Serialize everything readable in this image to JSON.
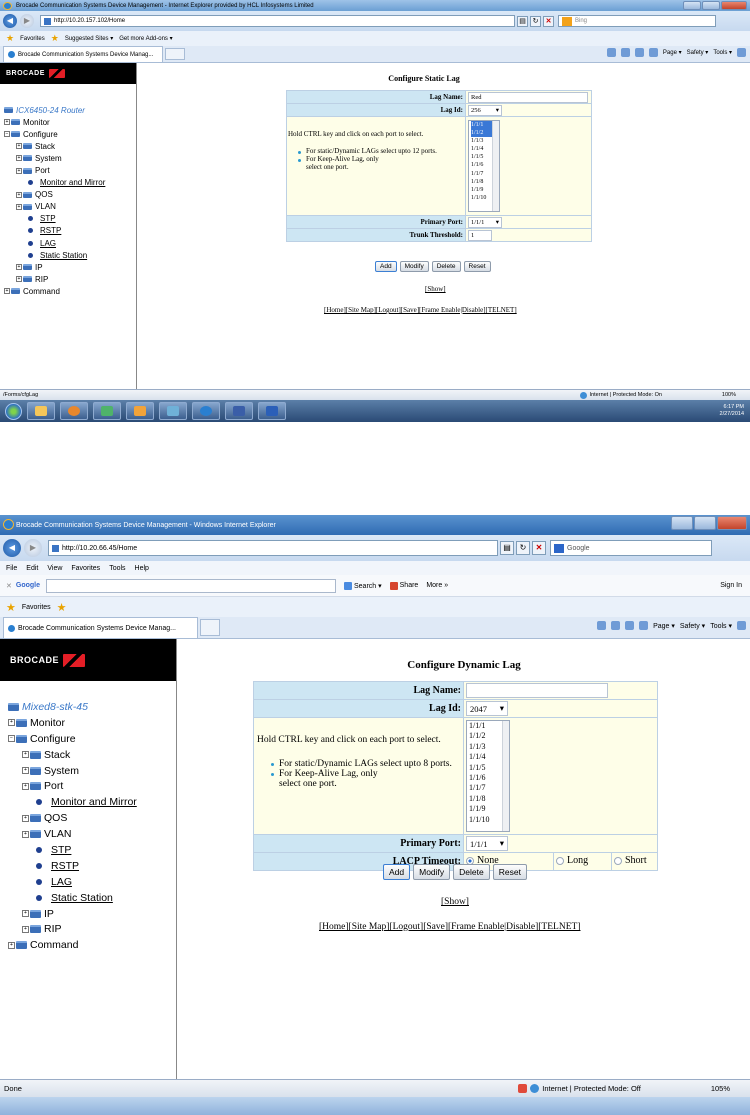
{
  "shot1": {
    "window_title": "Brocade Communication Systems Device Management - Internet Explorer provided by HCL Infosystems Limited",
    "address": "http://10.20.157.102/Home",
    "search_placeholder": "Bing",
    "favorites": [
      "Favorites",
      "Suggested Sites ▾",
      "Get more Add-ons ▾"
    ],
    "tab_title": "Brocade Communication Systems Device Manag...",
    "commands": [
      "Page ▾",
      "Safety ▾",
      "Tools ▾"
    ],
    "logo": "BROCADE",
    "tree": {
      "root": "ICX6450-24 Router",
      "monitor": "Monitor",
      "configure": "Configure",
      "stack": "Stack",
      "system": "System",
      "port": "Port",
      "monitor_mirror": "Monitor and Mirror",
      "qos": "QOS",
      "vlan": "VLAN",
      "stp": "STP",
      "rstp": "RSTP",
      "lag": "LAG",
      "static_station": "Static Station",
      "ip": "IP",
      "rip": "RIP",
      "command": "Command"
    },
    "page_title": "Configure Static Lag",
    "form": {
      "lag_name_label": "Lag Name:",
      "lag_name_value": "Red",
      "lag_id_label": "Lag Id:",
      "lag_id_value": "256",
      "hint": "Hold CTRL key and click on each port to select.",
      "bullet1": "For static/Dynamic LAGs select upto 12 ports.",
      "bullet2a": "For Keep-Alive Lag, only",
      "bullet2b": "select one port.",
      "ports": [
        "1/1/1",
        "1/1/2",
        "1/1/3",
        "1/1/4",
        "1/1/5",
        "1/1/6",
        "1/1/7",
        "1/1/8",
        "1/1/9",
        "1/1/10"
      ],
      "primary_port_label": "Primary Port:",
      "primary_port_value": "1/1/1",
      "trunk_label": "Trunk Threshold:",
      "trunk_value": "1"
    },
    "buttons": {
      "add": "Add",
      "modify": "Modify",
      "delete": "Delete",
      "reset": "Reset"
    },
    "show_link": "[Show]",
    "footer_links": "[Home][Site Map][Logout][Save][Frame Enable|Disable][TELNET]",
    "status_left": "/Forms/cfgLag",
    "status_zone": "Internet | Protected Mode: On",
    "zoom": "100%",
    "clock_time": "6:17 PM",
    "clock_date": "2/27/2014"
  },
  "shot2": {
    "window_title": "Brocade Communication Systems Device Management - Windows Internet Explorer",
    "address": "http://10.20.66.45/Home",
    "search_placeholder": "Google",
    "menu": [
      "File",
      "Edit",
      "View",
      "Favorites",
      "Tools",
      "Help"
    ],
    "google_label": "Google",
    "google_buttons": [
      "Search ▾",
      "Share",
      "More »"
    ],
    "sign_in": "Sign In",
    "favorites": [
      "Favorites"
    ],
    "tab_title": "Brocade Communication Systems Device Manag...",
    "commands": [
      "Page ▾",
      "Safety ▾",
      "Tools ▾"
    ],
    "logo": "BROCADE",
    "tree": {
      "root": "Mixed8-stk-45",
      "monitor": "Monitor",
      "configure": "Configure",
      "stack": "Stack",
      "system": "System",
      "port": "Port",
      "monitor_mirror": "Monitor and Mirror",
      "qos": "QOS",
      "vlan": "VLAN",
      "stp": "STP",
      "rstp": "RSTP",
      "lag": "LAG",
      "static_station": "Static Station",
      "ip": "IP",
      "rip": "RIP",
      "command": "Command"
    },
    "page_title": "Configure Dynamic Lag",
    "form": {
      "lag_name_label": "Lag Name:",
      "lag_name_value": "",
      "lag_id_label": "Lag Id:",
      "lag_id_value": "2047",
      "hint": "Hold CTRL key and click on each port to select.",
      "bullet1": "For static/Dynamic LAGs select upto 8 ports.",
      "bullet2a": "For Keep-Alive Lag, only",
      "bullet2b": "select one port.",
      "ports": [
        "1/1/1",
        "1/1/2",
        "1/1/3",
        "1/1/4",
        "1/1/5",
        "1/1/6",
        "1/1/7",
        "1/1/8",
        "1/1/9",
        "1/1/10"
      ],
      "primary_port_label": "Primary Port:",
      "primary_port_value": "1/1/1",
      "lacp_label": "LACP Timeout:",
      "lacp_options": [
        "None",
        "Long",
        "Short"
      ]
    },
    "buttons": {
      "add": "Add",
      "modify": "Modify",
      "delete": "Delete",
      "reset": "Reset"
    },
    "show_link": "[Show]",
    "footer_links": "[Home][Site Map][Logout][Save][Frame Enable|Disable][TELNET]",
    "status_left": "Done",
    "status_zone": "Internet | Protected Mode: Off",
    "zoom": "105%"
  }
}
